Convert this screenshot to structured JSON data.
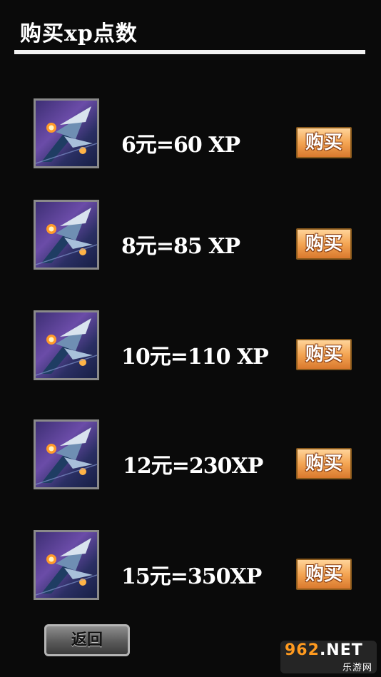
{
  "header": {
    "title": "购买xp点数"
  },
  "offers": [
    {
      "price_label": "6元=60 XP",
      "buy_label": "购买",
      "icon": "fighter-jet-icon"
    },
    {
      "price_label": "8元=85 XP",
      "buy_label": "购买",
      "icon": "fighter-jet-icon"
    },
    {
      "price_label": "10元=110 XP",
      "buy_label": "购买",
      "icon": "fighter-jet-icon"
    },
    {
      "price_label": "12元=230XP",
      "buy_label": "购买",
      "icon": "fighter-jet-icon"
    },
    {
      "price_label": "15元=350XP",
      "buy_label": "购买",
      "icon": "fighter-jet-icon"
    }
  ],
  "footer": {
    "back_label": "返回"
  },
  "watermark": {
    "logo_text": "962.NET",
    "site_text": "乐游网"
  },
  "colors": {
    "background": "#0a0a0a",
    "buy_button": "#f4a553",
    "back_button": "#5a5a5a",
    "text": "#ffffff"
  }
}
